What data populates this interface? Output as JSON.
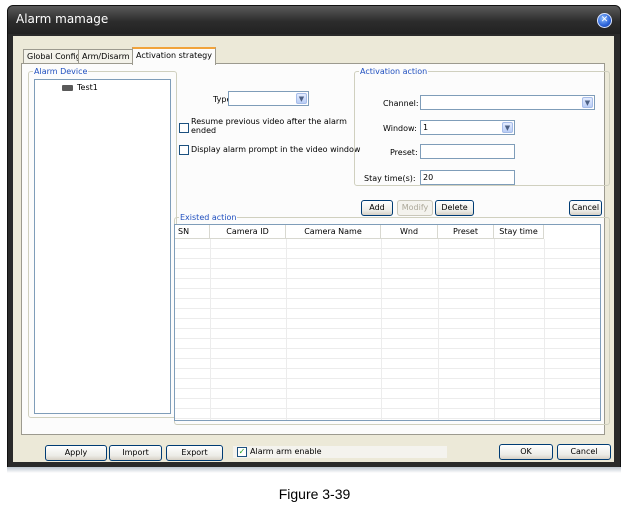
{
  "window": {
    "title": "Alarm mamage",
    "close_icon": "close-icon"
  },
  "tabs": [
    {
      "label": "Global Config",
      "active": false
    },
    {
      "label": "Arm/Disarm",
      "active": false
    },
    {
      "label": "Activation strategy",
      "active": true
    }
  ],
  "alarm_device": {
    "legend": "Alarm Device",
    "items": [
      {
        "label": "Test1",
        "icon": "device-icon"
      }
    ]
  },
  "options": {
    "type_label": "Type:",
    "type_value": "",
    "resume_label": "Resume previous video after the alarm ended",
    "resume_line1": "Resume previous video after the alarm",
    "resume_line2": "ended",
    "resume_checked": false,
    "prompt_label": "Display alarm prompt in the video window",
    "prompt_checked": false
  },
  "activation_action": {
    "legend": "Activation action",
    "channel_label": "Channel:",
    "channel_value": "",
    "window_label": "Window:",
    "window_value": "1",
    "preset_label": "Preset:",
    "preset_value": "",
    "stay_label": "Stay time(s):",
    "stay_value": "20"
  },
  "action_buttons": {
    "add": "Add",
    "modify": "Modify",
    "delete": "Delete",
    "cancel": "Cancel"
  },
  "existed_action": {
    "legend": "Existed action",
    "columns": [
      "SN",
      "Camera ID",
      "Camera Name",
      "Wnd",
      "Preset",
      "Stay time"
    ],
    "rows": []
  },
  "footer": {
    "apply": "Apply",
    "import": "Import",
    "export": "Export",
    "alarm_arm_label": "Alarm arm enable",
    "alarm_arm_checked": true,
    "ok": "OK",
    "cancel": "Cancel"
  },
  "caption": "Figure 3-39",
  "colors": {
    "title_bar": "#2c2c2c",
    "client_bg": "#ece9d8",
    "legend_text": "#1f4fbf",
    "active_tab_accent": "#f1a33b"
  }
}
